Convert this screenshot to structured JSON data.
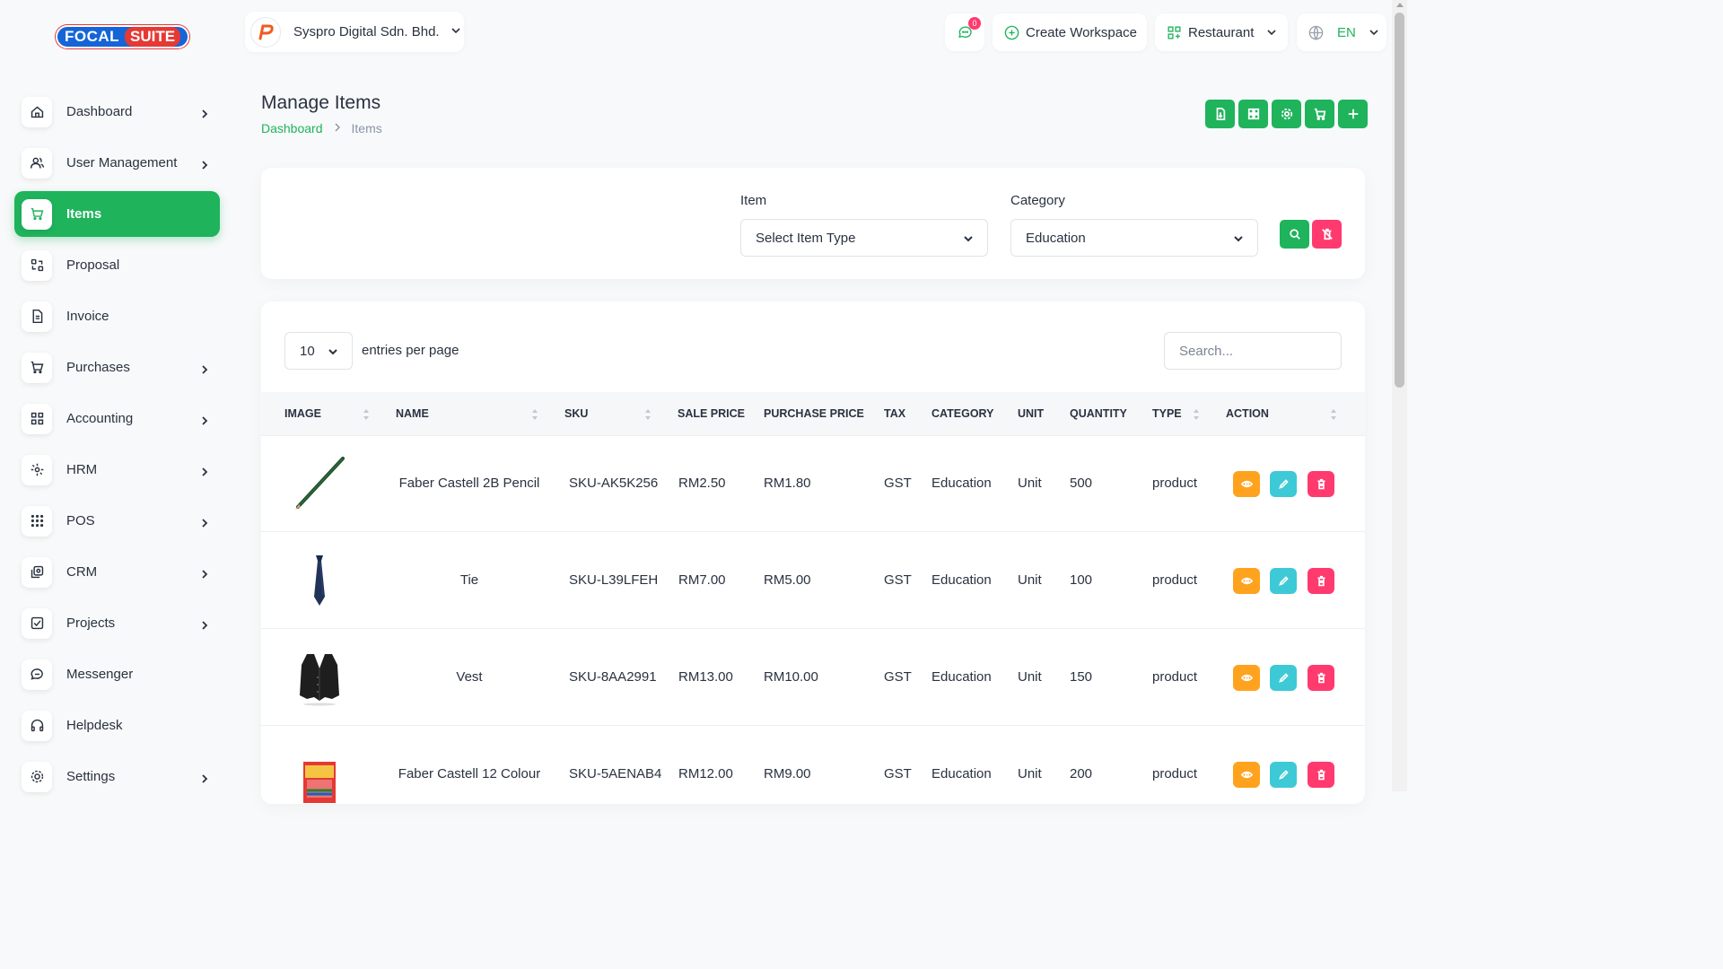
{
  "brand": {
    "logo_part1": "FOCAL",
    "logo_part2": "SUITE"
  },
  "sidebar": {
    "items": [
      {
        "label": "Dashboard",
        "icon": "home-icon",
        "has_children": true
      },
      {
        "label": "User Management",
        "icon": "users-icon",
        "has_children": true
      },
      {
        "label": "Items",
        "icon": "cart-icon",
        "has_children": false,
        "active": true
      },
      {
        "label": "Proposal",
        "icon": "proposal-icon",
        "has_children": false
      },
      {
        "label": "Invoice",
        "icon": "invoice-icon",
        "has_children": false
      },
      {
        "label": "Purchases",
        "icon": "cart-icon",
        "has_children": true
      },
      {
        "label": "Accounting",
        "icon": "grid-icon",
        "has_children": true
      },
      {
        "label": "HRM",
        "icon": "hrm-icon",
        "has_children": true
      },
      {
        "label": "POS",
        "icon": "dots-grid-icon",
        "has_children": true
      },
      {
        "label": "CRM",
        "icon": "crm-icon",
        "has_children": true
      },
      {
        "label": "Projects",
        "icon": "checkbox-icon",
        "has_children": true
      },
      {
        "label": "Messenger",
        "icon": "chat-icon",
        "has_children": false
      },
      {
        "label": "Helpdesk",
        "icon": "headphones-icon",
        "has_children": false
      },
      {
        "label": "Settings",
        "icon": "gear-icon",
        "has_children": true
      }
    ]
  },
  "header": {
    "company": "Syspro Digital Sdn. Bhd.",
    "notification_count": "0",
    "create_workspace": "Create Workspace",
    "workspace": "Restaurant",
    "language": "EN"
  },
  "page": {
    "title": "Manage Items",
    "breadcrumb": [
      "Dashboard",
      "Items"
    ]
  },
  "filters": {
    "item_label": "Item",
    "item_value": "Select Item Type",
    "category_label": "Category",
    "category_value": "Education"
  },
  "table": {
    "per_page": "10",
    "per_page_label": "entries per page",
    "search_placeholder": "Search...",
    "columns": [
      "IMAGE",
      "NAME",
      "SKU",
      "SALE PRICE",
      "PURCHASE PRICE",
      "TAX",
      "CATEGORY",
      "UNIT",
      "QUANTITY",
      "TYPE",
      "ACTION"
    ],
    "rows": [
      {
        "image": "pencil",
        "name": "Faber Castell 2B Pencil",
        "sku": "SKU-AK5K256",
        "sale_price": "RM2.50",
        "purchase_price": "RM1.80",
        "tax": "GST",
        "category": "Education",
        "unit": "Unit",
        "quantity": "500",
        "type": "product"
      },
      {
        "image": "tie",
        "name": "Tie",
        "sku": "SKU-L39LFEH",
        "sale_price": "RM7.00",
        "purchase_price": "RM5.00",
        "tax": "GST",
        "category": "Education",
        "unit": "Unit",
        "quantity": "100",
        "type": "product"
      },
      {
        "image": "vest",
        "name": "Vest",
        "sku": "SKU-8AA2991",
        "sale_price": "RM13.00",
        "purchase_price": "RM10.00",
        "tax": "GST",
        "category": "Education",
        "unit": "Unit",
        "quantity": "150",
        "type": "product"
      },
      {
        "image": "colour-pencils",
        "name": "Faber Castell 12 Colour",
        "sku": "SKU-5AENAB4",
        "sale_price": "RM12.00",
        "purchase_price": "RM9.00",
        "tax": "GST",
        "category": "Education",
        "unit": "Unit",
        "quantity": "200",
        "type": "product"
      }
    ]
  },
  "colors": {
    "primary": "#1fb35c",
    "danger": "#ff3a6e",
    "warning": "#ffa21d",
    "info": "#3ec9d6"
  }
}
